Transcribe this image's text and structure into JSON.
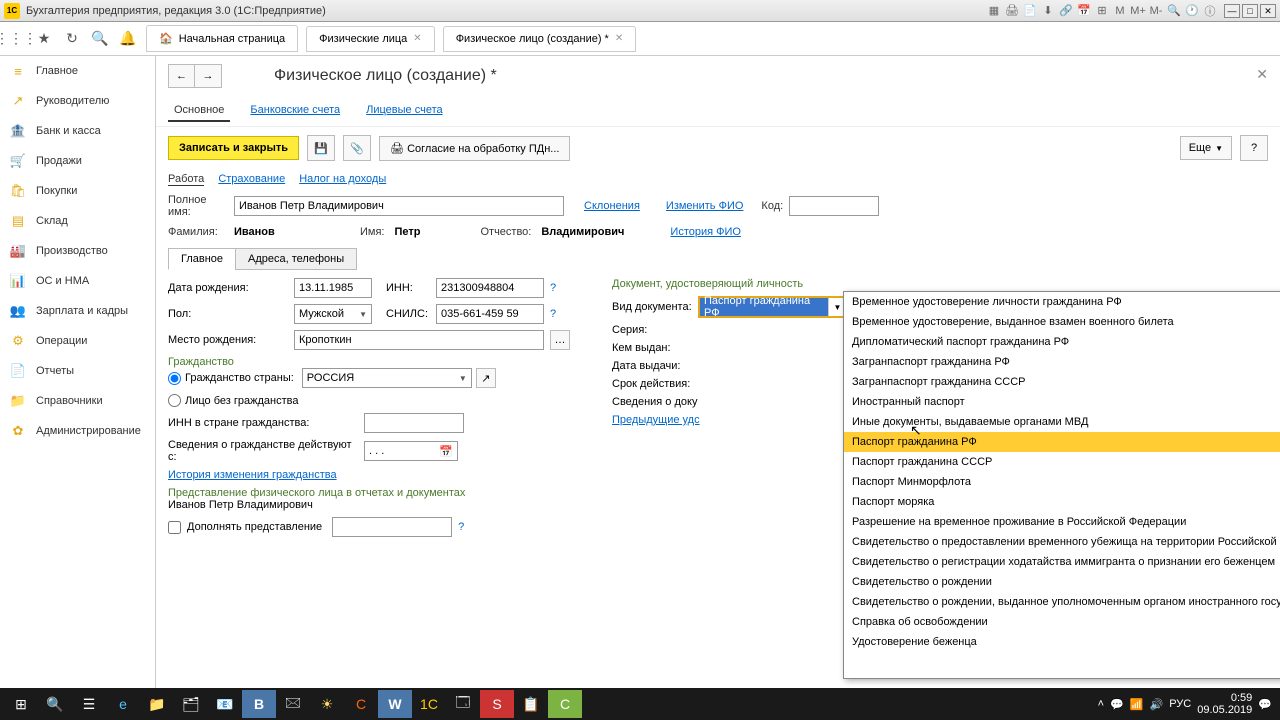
{
  "app": {
    "title": "Бухгалтерия предприятия, редакция 3.0 (1С:Предприятие)",
    "logo": "1С"
  },
  "tabs": {
    "home": "Начальная страница",
    "t1": "Физические лица",
    "t2": "Физическое лицо (создание) *"
  },
  "sidebar": {
    "items": [
      {
        "icon": "≡",
        "label": "Главное"
      },
      {
        "icon": "↗",
        "label": "Руководителю"
      },
      {
        "icon": "🏦",
        "label": "Банк и касса"
      },
      {
        "icon": "🛒",
        "label": "Продажи"
      },
      {
        "icon": "🛍",
        "label": "Покупки"
      },
      {
        "icon": "▤",
        "label": "Склад"
      },
      {
        "icon": "🏭",
        "label": "Производство"
      },
      {
        "icon": "📊",
        "label": "ОС и НМА"
      },
      {
        "icon": "👥",
        "label": "Зарплата и кадры"
      },
      {
        "icon": "⚙",
        "label": "Операции"
      },
      {
        "icon": "📄",
        "label": "Отчеты"
      },
      {
        "icon": "📁",
        "label": "Справочники"
      },
      {
        "icon": "✿",
        "label": "Администрирование"
      }
    ]
  },
  "page": {
    "title": "Физическое лицо (создание) *",
    "subtabs": {
      "main": "Основное",
      "bank": "Банковские счета",
      "lic": "Лицевые счета"
    },
    "actions": {
      "save": "Записать и закрыть",
      "consent": "Согласие на обработку ПДн...",
      "more": "Еще"
    },
    "links": {
      "work": "Работа",
      "ins": "Страхование",
      "tax": "Налог на доходы"
    },
    "fullname_lb": "Полное имя:",
    "fullname": "Иванов Петр Владимирович",
    "decl": "Склонения",
    "change": "Изменить ФИО",
    "code_lb": "Код:",
    "hist": "История ФИО",
    "fam_lb": "Фамилия:",
    "fam": "Иванов",
    "name_lb": "Имя:",
    "name": "Петр",
    "otch_lb": "Отчество:",
    "otch": "Владимирович",
    "innertabs": {
      "main": "Главное",
      "addr": "Адреса, телефоны"
    },
    "dob_lb": "Дата рождения:",
    "dob": "13.11.1985",
    "inn_lb": "ИНН:",
    "inn": "231300948804",
    "sex_lb": "Пол:",
    "sex": "Мужской",
    "snils_lb": "СНИЛС:",
    "snils": "035-661-459 59",
    "pob_lb": "Место рождения:",
    "pob": "Кропоткин",
    "citiz_head": "Гражданство",
    "citiz_rb": "Гражданство страны:",
    "citiz": "РОССИЯ",
    "noc_rb": "Лицо без гражданства",
    "inn2_lb": "ИНН в стране гражданства:",
    "cinfo_lb": "Сведения о гражданстве действуют с:",
    "cinfo_val": ". . .",
    "cithist": "История изменения гражданства",
    "repr_head": "Представление физического лица в отчетах и документах",
    "repr_name": "Иванов Петр Владимирович",
    "addrepr_lb": "Дополнять представление",
    "doc_head": "Документ, удостоверяющий личность",
    "doc_kind_lb": "Вид документа:",
    "doc_kind": "Паспорт гражданина РФ",
    "ser_lb": "Серия:",
    "who_lb": "Кем выдан:",
    "issd_lb": "Дата выдачи:",
    "valid_lb": "Срок действия:",
    "docinfo_lb": "Сведения о доку",
    "prevdoc": "Предыдущие удс"
  },
  "dropdown": {
    "items": [
      "Временное удостоверение личности гражданина РФ",
      "Временное удостоверение, выданное взамен военного билета",
      "Дипломатический паспорт гражданина РФ",
      "Загранпаспорт гражданина РФ",
      "Загранпаспорт гражданина СССР",
      "Иностранный паспорт",
      "Иные документы, выдаваемые органами МВД",
      "Паспорт гражданина РФ",
      "Паспорт гражданина СССР",
      "Паспорт Минморфлота",
      "Паспорт моряка",
      "Разрешение на временное проживание в Российской Федерации",
      "Свидетельство о предоставлении временного убежища на территории Российской Федер...",
      "Свидетельство о регистрации ходатайства иммигранта о признании его беженцем",
      "Свидетельство о рождении",
      "Свидетельство о рождении, выданное уполномоченным органом иностранного государства",
      "Справка об освобождении",
      "Удостоверение беженца"
    ],
    "selected": 7
  },
  "taskbar": {
    "time": "0:59",
    "date": "09.05.2019"
  }
}
